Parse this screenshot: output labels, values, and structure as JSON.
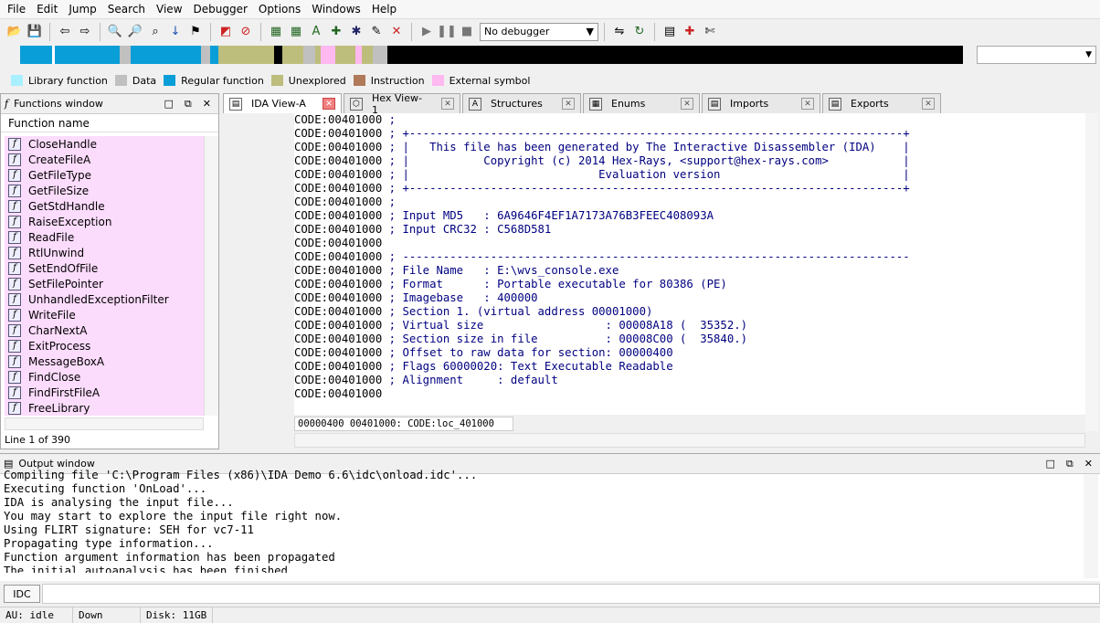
{
  "menu": [
    "File",
    "Edit",
    "Jump",
    "Search",
    "View",
    "Debugger",
    "Options",
    "Windows",
    "Help"
  ],
  "toolbar": {
    "debugger_select": "No debugger"
  },
  "legend": [
    {
      "label": "Library function",
      "color": "#a8f0ff"
    },
    {
      "label": "Data",
      "color": "#c0c0c0"
    },
    {
      "label": "Regular function",
      "color": "#0a9ed8"
    },
    {
      "label": "Unexplored",
      "color": "#bdbd7c"
    },
    {
      "label": "Instruction",
      "color": "#b07a5a"
    },
    {
      "label": "External symbol",
      "color": "#ffb8f0"
    }
  ],
  "functions": {
    "title": "Functions window",
    "column": "Function name",
    "items": [
      "CloseHandle",
      "CreateFileA",
      "GetFileType",
      "GetFileSize",
      "GetStdHandle",
      "RaiseException",
      "ReadFile",
      "RtlUnwind",
      "SetEndOfFile",
      "SetFilePointer",
      "UnhandledExceptionFilter",
      "WriteFile",
      "CharNextA",
      "ExitProcess",
      "MessageBoxA",
      "FindClose",
      "FindFirstFileA",
      "FreeLibrary"
    ],
    "status": "Line 1 of 390"
  },
  "tabs": [
    "IDA View-A",
    "Hex View-1",
    "Structures",
    "Enums",
    "Imports",
    "Exports"
  ],
  "ida": {
    "lines": [
      {
        "addr": "CODE:00401000",
        "text": " ;"
      },
      {
        "addr": "CODE:00401000",
        "text": " ; +-------------------------------------------------------------------------+"
      },
      {
        "addr": "CODE:00401000",
        "text": " ; |   This file has been generated by The Interactive Disassembler (IDA)    |"
      },
      {
        "addr": "CODE:00401000",
        "text": " ; |           Copyright (c) 2014 Hex-Rays, <support@hex-rays.com>           |"
      },
      {
        "addr": "CODE:00401000",
        "text": " ; |                            Evaluation version                           |"
      },
      {
        "addr": "CODE:00401000",
        "text": " ; +-------------------------------------------------------------------------+"
      },
      {
        "addr": "CODE:00401000",
        "text": " ;"
      },
      {
        "addr": "CODE:00401000",
        "text": " ; Input MD5   : 6A9646F4EF1A7173A76B3FEEC408093A"
      },
      {
        "addr": "CODE:00401000",
        "text": " ; Input CRC32 : C568D581"
      },
      {
        "addr": "CODE:00401000",
        "text": ""
      },
      {
        "addr": "CODE:00401000",
        "text": " ; ---------------------------------------------------------------------------"
      },
      {
        "addr": "CODE:00401000",
        "text": " ; File Name   : E:\\wvs_console.exe"
      },
      {
        "addr": "CODE:00401000",
        "text": " ; Format      : Portable executable for 80386 (PE)"
      },
      {
        "addr": "CODE:00401000",
        "text": " ; Imagebase   : 400000"
      },
      {
        "addr": "CODE:00401000",
        "text": " ; Section 1. (virtual address 00001000)"
      },
      {
        "addr": "CODE:00401000",
        "text": " ; Virtual size                  : 00008A18 (  35352.)"
      },
      {
        "addr": "CODE:00401000",
        "text": " ; Section size in file          : 00008C00 (  35840.)"
      },
      {
        "addr": "CODE:00401000",
        "text": " ; Offset to raw data for section: 00000400"
      },
      {
        "addr": "CODE:00401000",
        "text": " ; Flags 60000020: Text Executable Readable"
      },
      {
        "addr": "CODE:00401000",
        "text": " ; Alignment     : default"
      },
      {
        "addr": "CODE:00401000",
        "text": ""
      }
    ],
    "status": "00000400 00401000: CODE:loc_401000"
  },
  "output": {
    "title": "Output window",
    "lines": [
      "Compiling file 'C:\\Program Files (x86)\\IDA Demo 6.6\\idc\\onload.idc'...",
      "Executing function 'OnLoad'...",
      "IDA is analysing the input file...",
      "You may start to explore the input file right now.",
      "Using FLIRT signature: SEH for vc7-11",
      "Propagating type information...",
      "Function argument information has been propagated",
      "The initial autoanalysis has been finished."
    ]
  },
  "cmd": {
    "button": "IDC"
  },
  "status": {
    "au": "AU:  idle",
    "dir": "Down",
    "disk": "Disk: 11GB"
  }
}
